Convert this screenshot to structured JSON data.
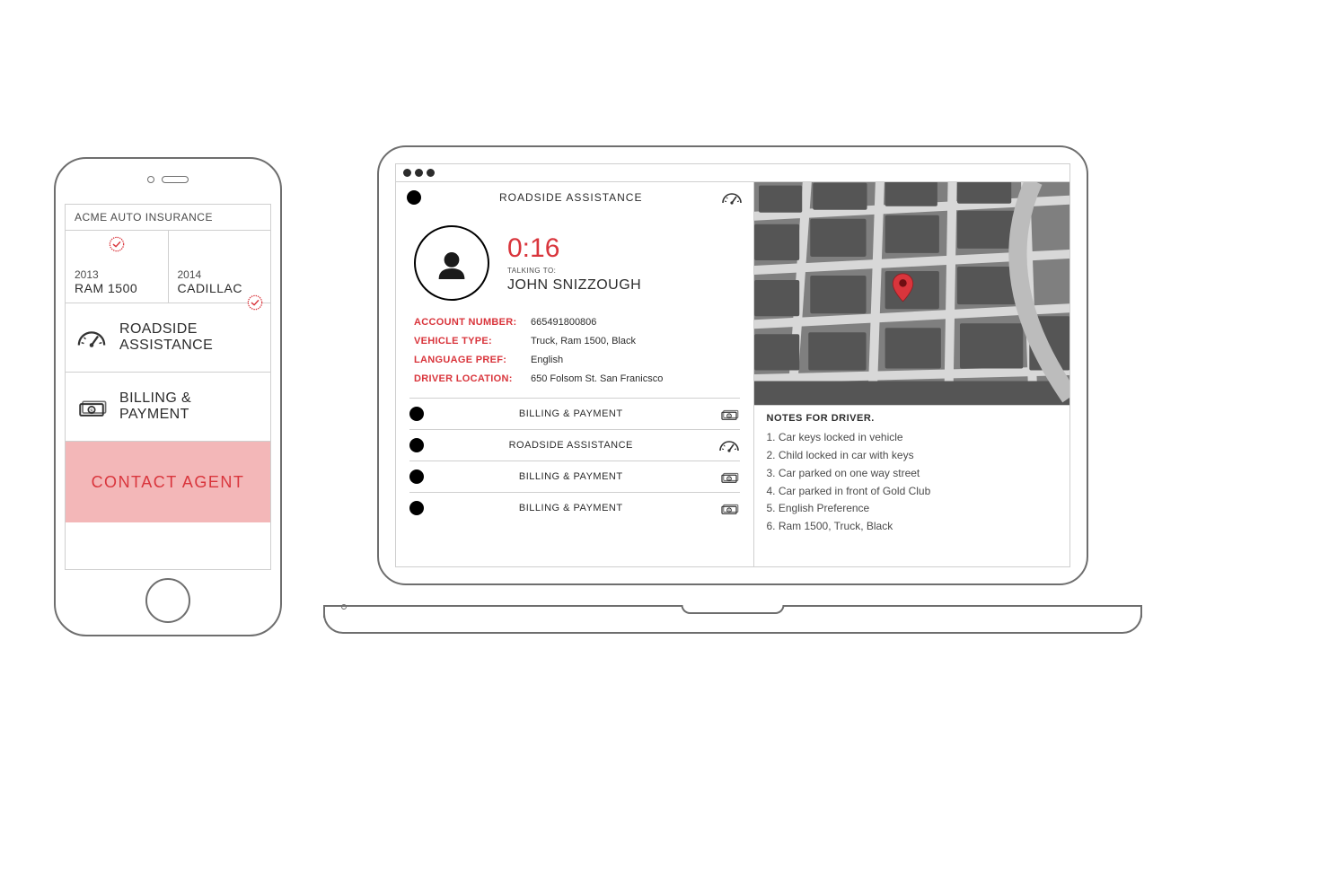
{
  "phone": {
    "app_title": "ACME AUTO INSURANCE",
    "vehicles": [
      {
        "year": "2013",
        "model": "RAM 1500"
      },
      {
        "year": "2014",
        "model": "CADILLAC"
      }
    ],
    "menu": [
      {
        "line1": "ROADSIDE",
        "line2": "ASSISTANCE",
        "icon": "gauge",
        "stamp": true
      },
      {
        "line1": "BILLING &",
        "line2": "PAYMENT",
        "icon": "cash",
        "stamp": false
      }
    ],
    "contact_agent": "CONTACT AGENT"
  },
  "laptop": {
    "header_title": "ROADSIDE ASSISTANCE",
    "call": {
      "timer": "0:16",
      "talking_label": "TALKING TO:",
      "name": "JOHN SNIZZOUGH"
    },
    "details": [
      {
        "k": "ACCOUNT NUMBER:",
        "v": "665491800806"
      },
      {
        "k": "VEHICLE TYPE:",
        "v": "Truck, Ram 1500, Black"
      },
      {
        "k": "LANGUAGE PREF:",
        "v": "English"
      },
      {
        "k": "DRIVER LOCATION:",
        "v": "650 Folsom St. San Franicsco"
      }
    ],
    "history": [
      {
        "label": "BILLING & PAYMENT",
        "icon": "cash"
      },
      {
        "label": "ROADSIDE ASSISTANCE",
        "icon": "gauge"
      },
      {
        "label": "BILLING & PAYMENT",
        "icon": "cash"
      },
      {
        "label": "BILLING & PAYMENT",
        "icon": "cash"
      }
    ],
    "notes_header": "NOTES FOR DRIVER.",
    "notes": [
      "1. Car keys locked in vehicle",
      "2. Child locked in car with keys",
      "3. Car parked on one way street",
      "4. Car parked in front of Gold Club",
      "5. English Preference",
      "6. Ram 1500, Truck, Black"
    ]
  },
  "colors": {
    "accent": "#d9353c",
    "accent_light": "#f3b7b8"
  }
}
